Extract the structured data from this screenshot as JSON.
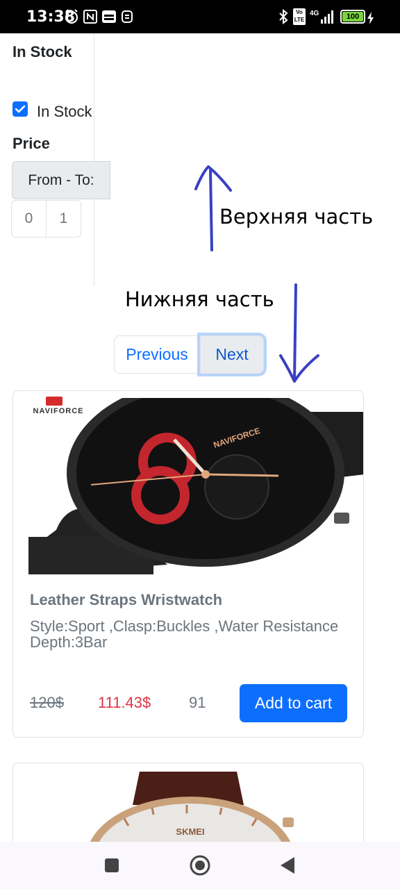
{
  "status_bar": {
    "time": "13:38",
    "network": "4G",
    "volte": "Vo LTE",
    "battery": "100"
  },
  "filters": {
    "in_stock": {
      "heading": "In Stock",
      "checkbox_label": "In Stock",
      "checked": true
    },
    "price": {
      "heading": "Price",
      "range_button": "From - To:",
      "from_value": "0",
      "to_value": "1"
    }
  },
  "annotations": {
    "top_label": "Верхняя часть",
    "bottom_label": "Нижняя часть"
  },
  "pagination": {
    "previous": "Previous",
    "next": "Next"
  },
  "products": [
    {
      "brand_logo": "NAVIFORCE",
      "dial_text": "NAVIFORCE",
      "title": "Leather Straps Wristwatch",
      "description": "Style:Sport ,Clasp:Buckles ,Water Resistance Depth:3Bar",
      "old_price": "120$",
      "price": "111.43$",
      "stock": "91",
      "button": "Add to cart"
    },
    {
      "dial_text": "SKMEI"
    }
  ],
  "colors": {
    "primary": "#0d6efd",
    "danger": "#dc3545",
    "muted": "#6c757d",
    "annotation_ink": "#3a3fc4"
  }
}
